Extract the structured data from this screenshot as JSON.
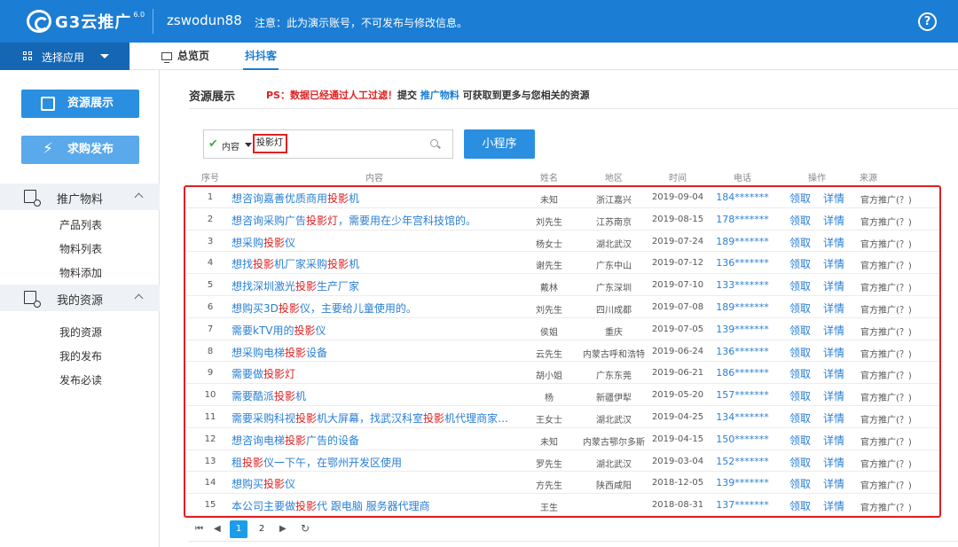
{
  "header": {
    "logo_text": "G3云推广",
    "version": "6.0",
    "username": "zswodun88",
    "notice": "注意：此为演示账号，不可发布与修改信息。",
    "help_icon": "help-icon"
  },
  "appbar": {
    "label": "选择应用"
  },
  "tabs": [
    {
      "label": "总览页"
    },
    {
      "label": "抖抖客"
    }
  ],
  "sidebar": {
    "buttons": [
      {
        "label": "资源展示",
        "icon": "edit-icon"
      },
      {
        "label": "求购发布",
        "icon": "bolt-icon"
      }
    ],
    "sections": [
      {
        "title": "推广物料",
        "items": [
          "产品列表",
          "物料列表",
          "物料添加"
        ]
      },
      {
        "title": "我的资源",
        "items": [
          "我的资源",
          "我的发布",
          "发布必读"
        ]
      }
    ]
  },
  "main": {
    "title": "资源展示",
    "ps_prefix": "PS：数据已经通过人工过滤！",
    "ps_submit": "提交 ",
    "ps_link": "推广物料",
    "ps_suffix": " 可获取到更多与您相关的资源",
    "search": {
      "scope": "内容",
      "query": "投影灯"
    },
    "mini_program_label": "小程序"
  },
  "table": {
    "columns": [
      "序号",
      "内容",
      "姓名",
      "地区",
      "时间",
      "电话",
      "操作",
      "来源"
    ],
    "action_claim": "领取",
    "action_detail": "详情",
    "rows": [
      {
        "no": "1",
        "parts": [
          "想咨询嘉善优质商用",
          "投影",
          "机"
        ],
        "name": "未知",
        "region": "浙江嘉兴",
        "date": "2019-09-04",
        "phone": "184*******",
        "source": "官方推广(？)"
      },
      {
        "no": "2",
        "parts": [
          "想咨询采购广告",
          "投影灯",
          "，需要用在少年宫科技馆的。"
        ],
        "name": "刘先生",
        "region": "江苏南京",
        "date": "2019-08-15",
        "phone": "178*******",
        "source": "官方推广(？)"
      },
      {
        "no": "3",
        "parts": [
          "想采购",
          "投影",
          "仪"
        ],
        "name": "杨女士",
        "region": "湖北武汉",
        "date": "2019-07-24",
        "phone": "189*******",
        "source": "官方推广(？)"
      },
      {
        "no": "4",
        "parts": [
          "想找",
          "投影",
          "机厂家采购",
          "投影",
          "机"
        ],
        "name": "谢先生",
        "region": "广东中山",
        "date": "2019-07-12",
        "phone": "136*******",
        "source": "官方推广(？)"
      },
      {
        "no": "5",
        "parts": [
          "想找深圳激光",
          "投影",
          "生产厂家"
        ],
        "name": "戴林",
        "region": "广东深圳",
        "date": "2019-07-10",
        "phone": "133*******",
        "source": "官方推广(？)"
      },
      {
        "no": "6",
        "parts": [
          "想购买3D",
          "投影",
          "仪，主要给儿童使用的。"
        ],
        "name": "刘先生",
        "region": "四川成都",
        "date": "2019-07-08",
        "phone": "189*******",
        "source": "官方推广(？)"
      },
      {
        "no": "7",
        "parts": [
          "需要kTV用的",
          "投影",
          "仪"
        ],
        "name": "侯姐",
        "region": "重庆",
        "date": "2019-07-05",
        "phone": "139*******",
        "source": "官方推广(？)"
      },
      {
        "no": "8",
        "parts": [
          "想采购电梯",
          "投影",
          "设备"
        ],
        "name": "云先生",
        "region": "内蒙古呼和浩特",
        "date": "2019-06-24",
        "phone": "136*******",
        "source": "官方推广(？)"
      },
      {
        "no": "9",
        "parts": [
          "需要做",
          "投影灯"
        ],
        "name": "胡小姐",
        "region": "广东东莞",
        "date": "2019-06-21",
        "phone": "186*******",
        "source": "官方推广(？)"
      },
      {
        "no": "10",
        "parts": [
          "需要酷派",
          "投影",
          "机"
        ],
        "name": "杨",
        "region": "新疆伊犁",
        "date": "2019-05-20",
        "phone": "157*******",
        "source": "官方推广(？)"
      },
      {
        "no": "11",
        "parts": [
          "需要采购科视",
          "投影",
          "机大屏幕，找武汉科室",
          "投影",
          "机代理商家，..."
        ],
        "name": "王女士",
        "region": "湖北武汉",
        "date": "2019-04-25",
        "phone": "134*******",
        "source": "官方推广(？)"
      },
      {
        "no": "12",
        "parts": [
          "想咨询电梯",
          "投影",
          "广告的设备"
        ],
        "name": "未知",
        "region": "内蒙古鄂尔多斯",
        "date": "2019-04-15",
        "phone": "150*******",
        "source": "官方推广(？)"
      },
      {
        "no": "13",
        "parts": [
          "租",
          "投影",
          "仪一下午，在鄂州开发区使用"
        ],
        "name": "罗先生",
        "region": "湖北武汉",
        "date": "2019-03-04",
        "phone": "152*******",
        "source": "官方推广(？)"
      },
      {
        "no": "14",
        "parts": [
          "想购买",
          "投影",
          "仪"
        ],
        "name": "方先生",
        "region": "陕西咸阳",
        "date": "2018-12-05",
        "phone": "139*******",
        "source": "官方推广(？)"
      },
      {
        "no": "15",
        "parts": [
          "本公司主要做",
          "投影",
          "代 跟电脑 服务器代理商"
        ],
        "name": "王生",
        "region": "",
        "date": "2018-08-31",
        "phone": "137*******",
        "source": "官方推广(？)"
      }
    ]
  },
  "pagination": {
    "pages": [
      "1",
      "2"
    ],
    "current": "1"
  },
  "colors": {
    "brand": "#1b7dd4",
    "highlight": "#e02020",
    "link": "#2a7fd4"
  }
}
